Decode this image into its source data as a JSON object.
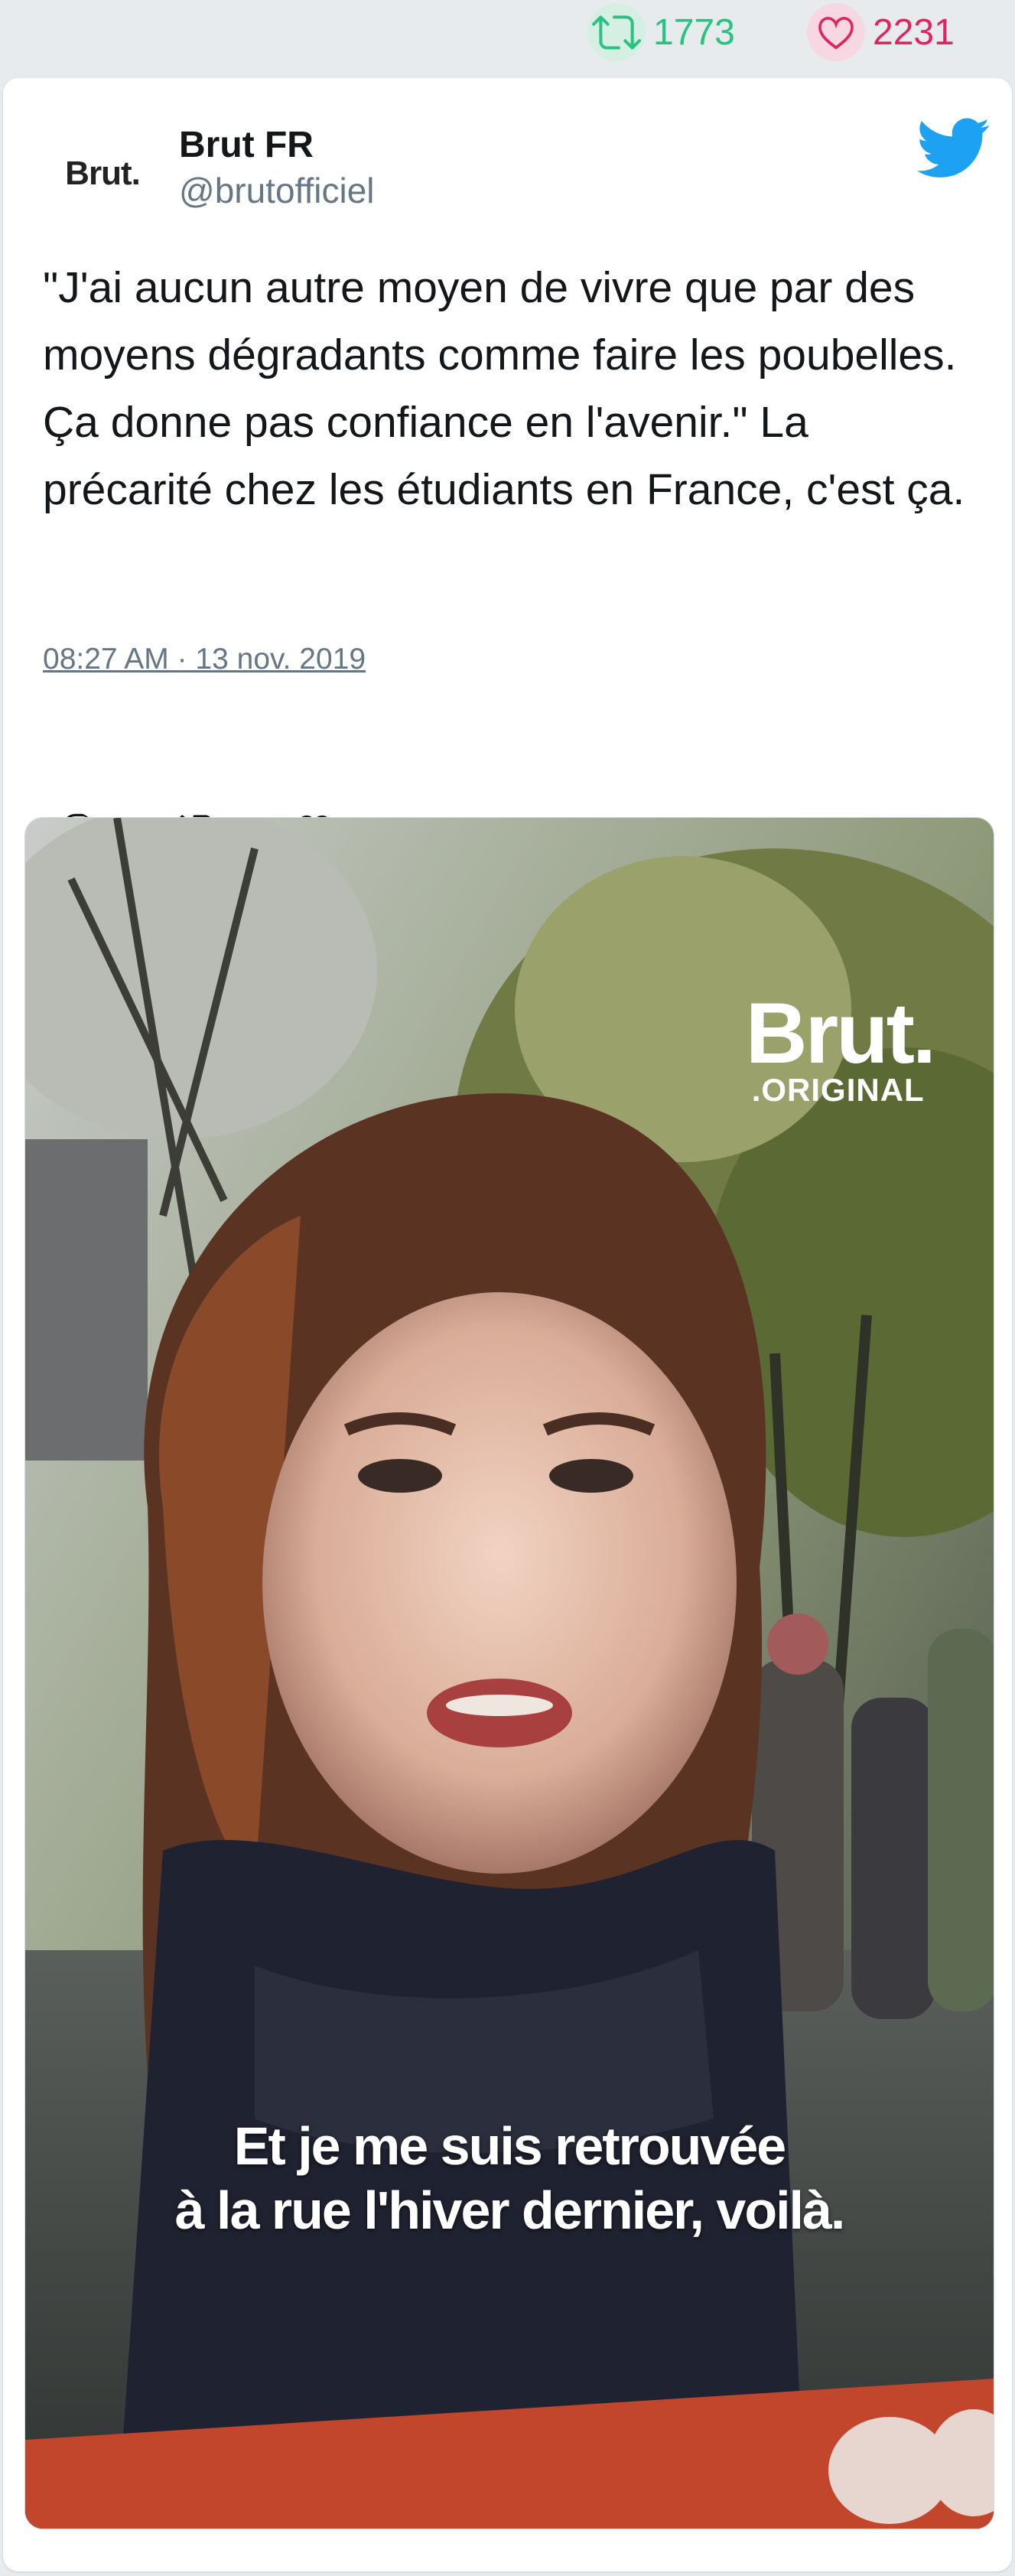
{
  "stats": {
    "retweets": "1773",
    "likes": "2231",
    "retweet_color": "#28c380",
    "like_color": "#e0245e"
  },
  "tweet": {
    "author_name": "Brut FR",
    "author_handle": "@brutofficiel",
    "avatar_text": "Brut.",
    "text": "\"J'ai aucun autre moyen de vivre que par des moyens dégradants comme faire les poubelles. Ça donne pas confiance en l'avenir.\" La précarité chez les étudiants en France, c'est ça.",
    "timestamp": "08:27 AM · 13 nov. 2019",
    "actions": [
      "reply-icon",
      "retweet-icon",
      "like-icon"
    ]
  },
  "media": {
    "brand_main": "Brut.",
    "brand_sub": ".ORIGINAL",
    "subtitle_line1": "Et je me suis retrouvée",
    "subtitle_line2": "à la rue l'hiver dernier, voilà."
  },
  "colors": {
    "twitter_blue": "#1da1f2",
    "text_dark": "#14171a",
    "text_muted": "#657786"
  }
}
